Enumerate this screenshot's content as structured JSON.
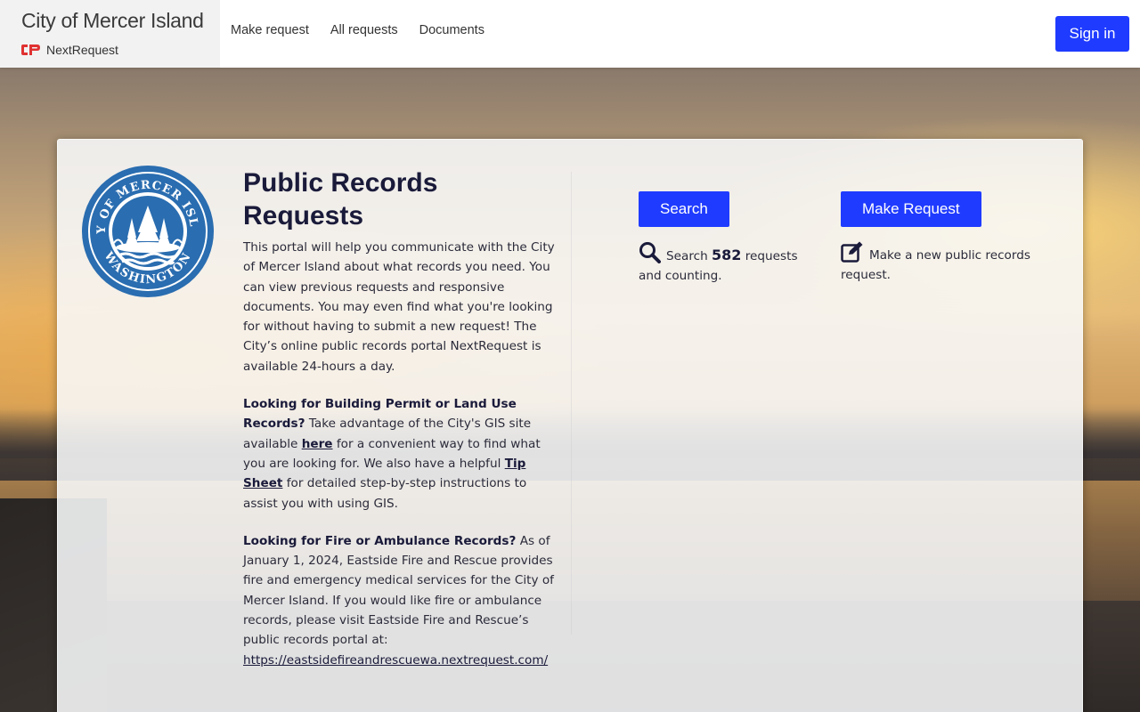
{
  "header": {
    "brand_title": "City of Mercer Island",
    "brand_sub": "NextRequest",
    "nav": [
      "Make request",
      "All requests",
      "Documents"
    ],
    "sign_in": "Sign in"
  },
  "seal": {
    "top_text": "CITY OF MERCER ISLAND",
    "bottom_text": "WASHINGTON"
  },
  "main": {
    "title": "Public Records Requests",
    "intro": "This portal will help you communicate with the City of Mercer Island about what records you need. You can view previous requests and responsive documents. You may even find what you're looking for without having to submit a new request! The City’s online public records portal NextRequest is available 24-hours a day.",
    "building": {
      "heading": "Looking for Building Permit or Land Use Records?",
      "text1": "Take advantage of the City's GIS site available",
      "link1": "here",
      "text2": "for a convenient way to find what you are looking for. We also have a helpful",
      "link2": "Tip Sheet",
      "text3": "for detailed step-by-step instructions to assist you with using GIS."
    },
    "fire": {
      "heading": "Looking for Fire or Ambulance Records?",
      "text": "As of January 1, 2024, Eastside Fire and Rescue provides fire and emergency medical services for the City of Mercer Island. If you would like fire or ambulance records, please visit Eastside Fire and Rescue’s public records portal at:",
      "link": "https://eastsidefireandrescuewa.nextrequest.com/"
    }
  },
  "actions": {
    "search": {
      "button": "Search",
      "pre": "Search",
      "count": "582",
      "post": "requests and counting.",
      "icon": "search-icon"
    },
    "make": {
      "button": "Make Request",
      "desc": "Make a new public records request.",
      "icon": "edit-icon"
    }
  },
  "colors": {
    "primary": "#1f3bff",
    "seal_blue": "#2a6db0"
  }
}
